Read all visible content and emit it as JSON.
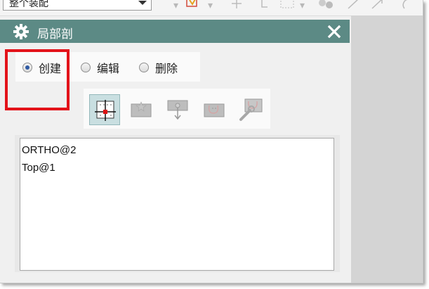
{
  "toolbar": {
    "filter_value": "整个装配"
  },
  "dialog": {
    "title": "局部剖",
    "title_icon": "gear-icon",
    "close_icon": "close-icon",
    "titlebar_color": "#5c8a85",
    "modes": [
      {
        "label": "创建",
        "selected": true
      },
      {
        "label": "编辑",
        "selected": false
      },
      {
        "label": "删除",
        "selected": false
      }
    ],
    "highlight_color": "#e3131a",
    "steps": [
      {
        "name": "select-view-icon",
        "selected": true
      },
      {
        "name": "base-point-icon",
        "selected": false
      },
      {
        "name": "extrude-vector-icon",
        "selected": false
      },
      {
        "name": "select-curves-icon",
        "selected": false
      },
      {
        "name": "modify-boundary-icon",
        "selected": false
      }
    ],
    "views": [
      "ORTHO@2",
      "Top@1"
    ]
  }
}
